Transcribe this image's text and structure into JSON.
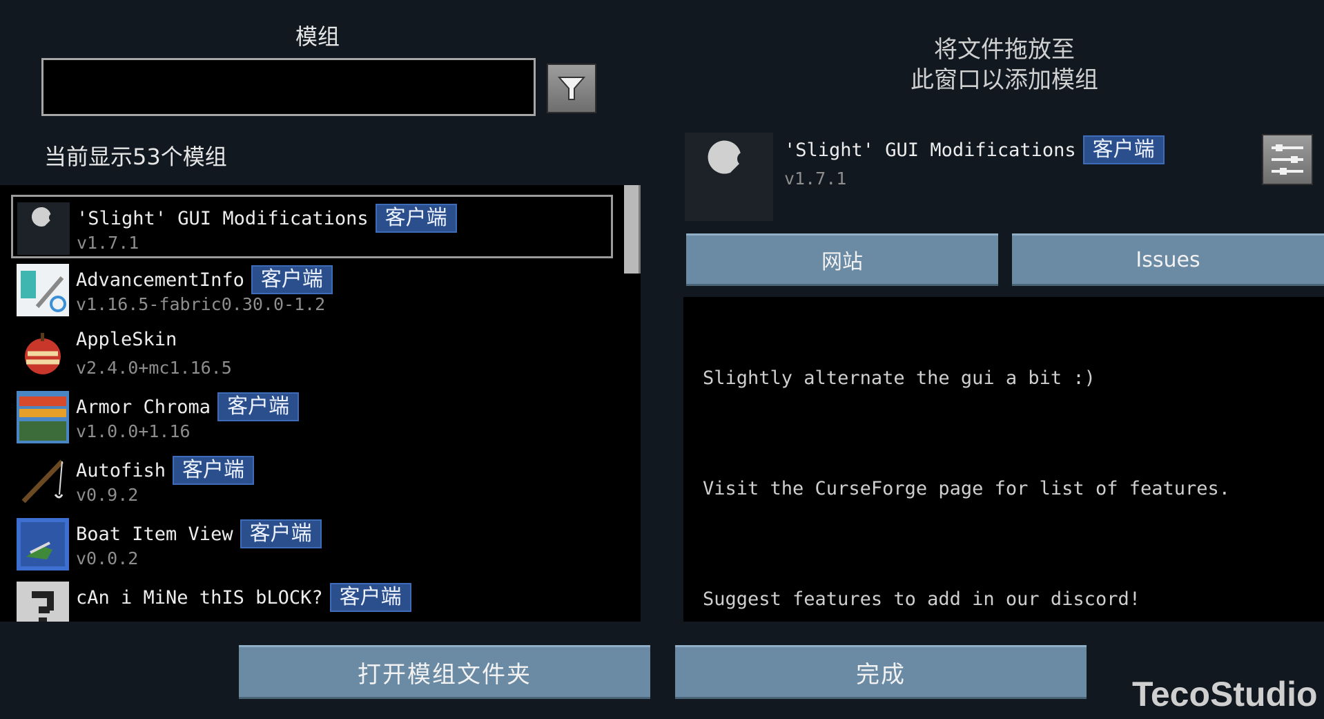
{
  "header": {
    "title": "模组"
  },
  "search": {
    "value": "",
    "placeholder": ""
  },
  "count_label": "当前显示53个模组",
  "drop_hint": {
    "line1": "将文件拖放至",
    "line2": "此窗口以添加模组"
  },
  "mods": [
    {
      "name": "'Slight' GUI Modifications",
      "version": "v1.7.1",
      "badge": "客户端",
      "icon": "wrench-icon",
      "selected": true
    },
    {
      "name": "AdvancementInfo",
      "version": "v1.16.5-fabric0.30.0-1.2",
      "badge": "客户端",
      "icon": "advancementinfo-icon"
    },
    {
      "name": "AppleSkin",
      "version": "v2.4.0+mc1.16.5",
      "badge": "",
      "icon": "apple-icon"
    },
    {
      "name": "Armor Chroma",
      "version": "v1.0.0+1.16",
      "badge": "客户端",
      "icon": "armor-chroma-icon"
    },
    {
      "name": "Autofish",
      "version": "v0.9.2",
      "badge": "客户端",
      "icon": "fishing-rod-icon"
    },
    {
      "name": "Boat Item View",
      "version": "v0.0.2",
      "badge": "客户端",
      "icon": "boat-icon"
    },
    {
      "name": "cAn i MiNe thIS bLOCK?",
      "version": "",
      "badge": "客户端",
      "icon": "pickaxe-icon"
    }
  ],
  "detail": {
    "name": "'Slight' GUI Modifications",
    "badge": "客户端",
    "version": "v1.7.1",
    "icon": "wrench-icon",
    "tabs": {
      "website": "网站",
      "issues": "Issues"
    },
    "description": [
      "Slightly alternate the gui a bit :)",
      "Visit the CurseForge page for list of features.",
      "Suggest features to add in our discord!"
    ]
  },
  "buttons": {
    "open_folder": "打开模组文件夹",
    "done": "完成"
  },
  "watermark": "TecoStudio",
  "colors": {
    "background": "#111820",
    "button": "#6b8aa3",
    "badge": "#2a4f8c"
  }
}
